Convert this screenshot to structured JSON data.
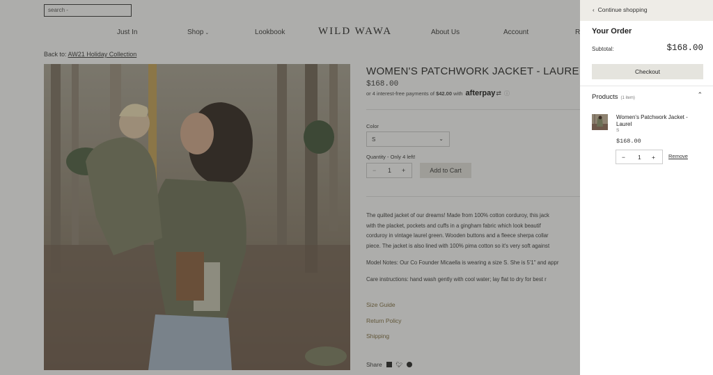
{
  "search": {
    "placeholder": "search -"
  },
  "nav": {
    "just_in": "Just In",
    "shop": "Shop",
    "lookbook": "Lookbook",
    "logo": "WILD WAWA",
    "about": "About Us",
    "account": "Account",
    "cut": "Re"
  },
  "breadcrumb": {
    "prefix": "Back to:",
    "link": "AW21 Holiday Collection"
  },
  "product": {
    "title": "WOMEN'S PATCHWORK JACKET - LAUREL",
    "price": "$168.00",
    "afterpay_pre": "or 4 interest-free payments of",
    "afterpay_amount": "$42.00",
    "afterpay_with": "with",
    "afterpay_brand": "afterpay",
    "color_label": "Color",
    "color_value": "S",
    "qty_label": "Quantity - Only 4 left!",
    "qty_minus": "−",
    "qty_value": "1",
    "qty_plus": "+",
    "add_to_cart": "Add to Cart",
    "desc1_l1": "The quilted jacket of our dreams! Made from 100% cotton corduroy, this jack",
    "desc1_l2": "with the placket, pockets and cuffs in a gingham fabric  which look beautif",
    "desc1_l3": "corduroy in vintage laurel green. Wooden buttons and a fleece sherpa collar",
    "desc1_l4": "piece. The jacket is also lined with 100% pima cotton so it's very soft against",
    "desc2": "Model Notes: Our Co Founder Micaella is wearing a size S. She is 5'1\" and appr",
    "desc3": "Care instructions: hand wash gently with cool water; lay flat to dry for best r",
    "size_guide": "Size Guide",
    "return_policy": "Return Policy",
    "shipping": "Shipping",
    "share": "Share"
  },
  "drawer": {
    "continue": "Continue shopping",
    "your_order": "Your Order",
    "subtotal_label": "Subtotal:",
    "subtotal_value": "$168.00",
    "checkout": "Checkout",
    "products_label": "Products",
    "products_count": "(1 item)",
    "item_name": "Women's Patchwork Jacket - Laurel",
    "item_variant": "S",
    "item_price": "$168.00",
    "item_qty": "1",
    "remove": "Remove"
  },
  "colors": {
    "accent_link": "#7d6a3a",
    "button_bg": "#e5e4de",
    "overlay": "rgba(60,60,55,0.42)"
  }
}
